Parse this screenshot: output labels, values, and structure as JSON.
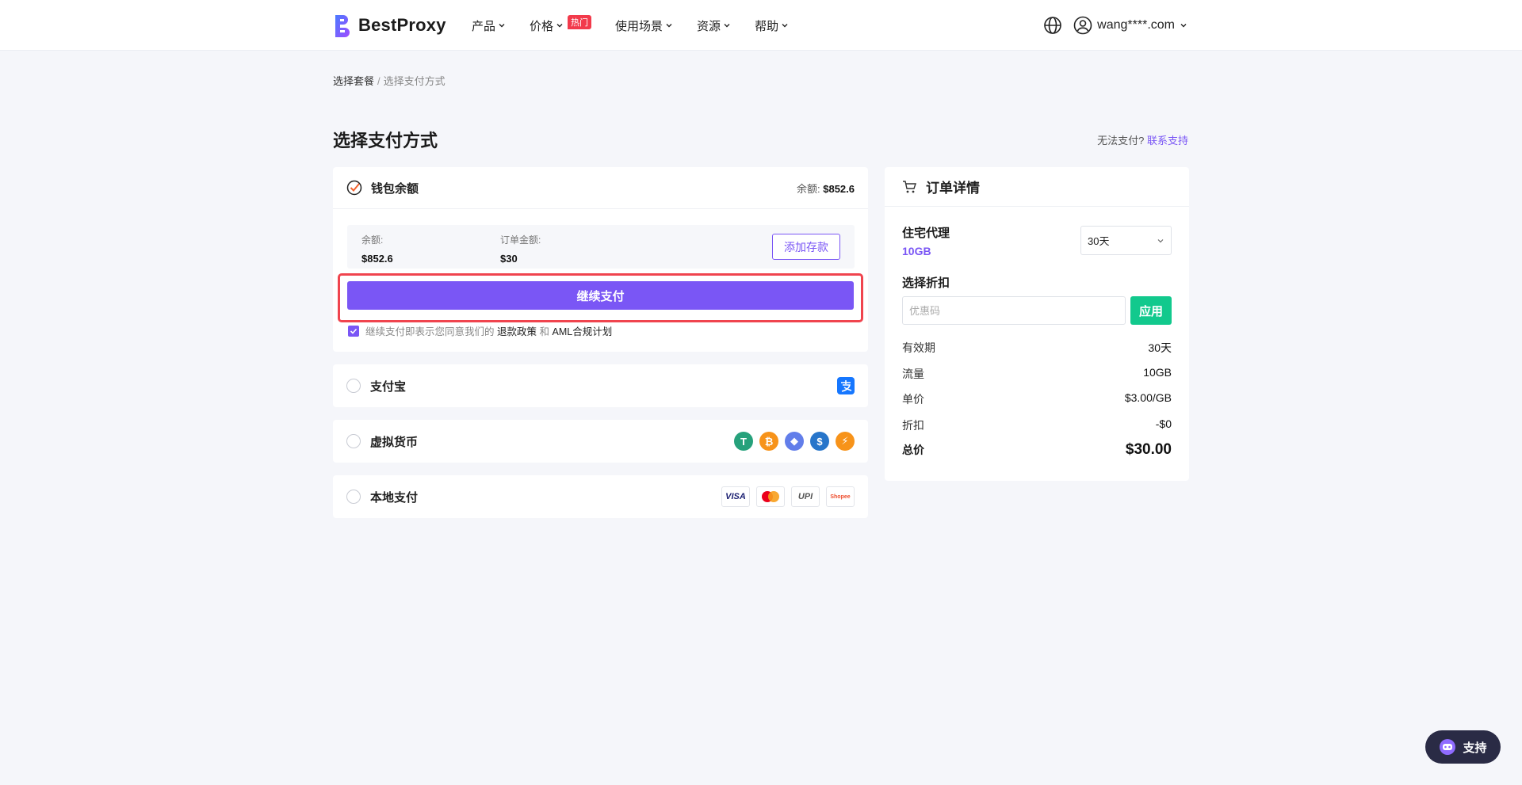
{
  "brand": {
    "name": "BestProxy"
  },
  "nav": {
    "items": [
      {
        "label": "产品"
      },
      {
        "label": "价格",
        "badge": "热门"
      },
      {
        "label": "使用场景"
      },
      {
        "label": "资源"
      },
      {
        "label": "帮助"
      }
    ]
  },
  "user": {
    "email": "wang****.com"
  },
  "breadcrumb": {
    "step1": "选择套餐",
    "separator": "/",
    "step2": "选择支付方式"
  },
  "page": {
    "title": "选择支付方式",
    "no_pay_text": "无法支付?",
    "contact_link": "联系支持"
  },
  "wallet": {
    "title": "钱包余额",
    "balance_label": "余额:",
    "balance_value": "$852.6",
    "info_balance_label": "余额:",
    "info_balance_value": "$852.6",
    "order_amount_label": "订单金额:",
    "order_amount_value": "$30",
    "add_funds": "添加存款",
    "continue_button": "继续支付",
    "agree_prefix": "继续支付即表示您同意我们的",
    "refund_policy": "退款政策",
    "and": "和",
    "aml_plan": "AML合规计划"
  },
  "payment_methods": [
    {
      "label": "支付宝"
    },
    {
      "label": "虚拟货币"
    },
    {
      "label": "本地支付"
    }
  ],
  "local_logos": {
    "visa": "VISA",
    "upi": "UPI",
    "shopee": "Shopee"
  },
  "order": {
    "title": "订单详情",
    "product": "住宅代理",
    "size": "10GB",
    "duration_selected": "30天",
    "discount_title": "选择折扣",
    "coupon_placeholder": "优惠码",
    "apply": "应用",
    "rows": [
      {
        "label": "有效期",
        "value": "30天"
      },
      {
        "label": "流量",
        "value": "10GB"
      },
      {
        "label": "单价",
        "value": "$3.00/GB"
      },
      {
        "label": "折扣",
        "value": "-$0"
      }
    ],
    "total_label": "总价",
    "total_value": "$30.00"
  },
  "support": {
    "label": "支持"
  },
  "colors": {
    "accent": "#7a56f5",
    "apply_green": "#12c98d",
    "highlight_red": "#f0444e",
    "hot_badge": "#f23a4b"
  }
}
